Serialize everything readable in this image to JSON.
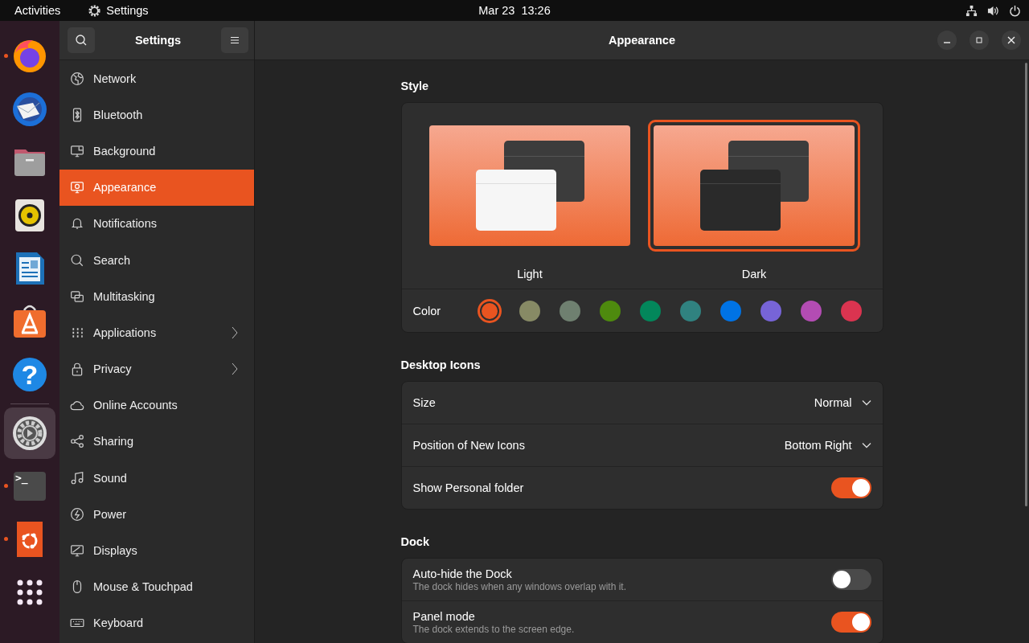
{
  "top_bar": {
    "activities": "Activities",
    "app_name": "Settings",
    "clock": "Mar 23  13:26"
  },
  "dock": {
    "items": [
      {
        "kind": "browser",
        "running": true,
        "selected": false
      },
      {
        "kind": "mail",
        "running": false,
        "selected": false
      },
      {
        "kind": "files",
        "running": false,
        "selected": false
      },
      {
        "kind": "music",
        "running": false,
        "selected": false
      },
      {
        "kind": "writer",
        "running": false,
        "selected": false
      },
      {
        "kind": "store",
        "running": false,
        "selected": false
      },
      {
        "kind": "help",
        "running": false,
        "selected": false,
        "glyph": "?"
      },
      {
        "kind": "separator"
      },
      {
        "kind": "settings",
        "running": true,
        "selected": true
      },
      {
        "kind": "terminal",
        "running": true,
        "selected": false,
        "glyph": ">_"
      },
      {
        "kind": "ubuntu",
        "running": true,
        "selected": false
      },
      {
        "kind": "apps",
        "running": false,
        "selected": false
      }
    ]
  },
  "sidebar": {
    "title": "Settings",
    "items": [
      {
        "label": "Network",
        "selected": false,
        "submenu": false
      },
      {
        "label": "Bluetooth",
        "selected": false,
        "submenu": false
      },
      {
        "label": "Background",
        "selected": false,
        "submenu": false
      },
      {
        "label": "Appearance",
        "selected": true,
        "submenu": false
      },
      {
        "label": "Notifications",
        "selected": false,
        "submenu": false
      },
      {
        "label": "Search",
        "selected": false,
        "submenu": false
      },
      {
        "label": "Multitasking",
        "selected": false,
        "submenu": false
      },
      {
        "label": "Applications",
        "selected": false,
        "submenu": true
      },
      {
        "label": "Privacy",
        "selected": false,
        "submenu": true
      },
      {
        "label": "Online Accounts",
        "selected": false,
        "submenu": false
      },
      {
        "label": "Sharing",
        "selected": false,
        "submenu": false
      },
      {
        "label": "Sound",
        "selected": false,
        "submenu": false
      },
      {
        "label": "Power",
        "selected": false,
        "submenu": false
      },
      {
        "label": "Displays",
        "selected": false,
        "submenu": false
      },
      {
        "label": "Mouse & Touchpad",
        "selected": false,
        "submenu": false
      },
      {
        "label": "Keyboard",
        "selected": false,
        "submenu": false
      }
    ]
  },
  "window": {
    "title": "Appearance"
  },
  "style": {
    "heading": "Style",
    "options": [
      {
        "label": "Light",
        "kind": "light",
        "selected": false
      },
      {
        "label": "Dark",
        "kind": "dark",
        "selected": true
      }
    ],
    "color_label": "Color",
    "colors": [
      {
        "color": "#e95420",
        "selected": true
      },
      {
        "color": "#878a65",
        "selected": false
      },
      {
        "color": "#6f8070",
        "selected": false
      },
      {
        "color": "#4e8a0e",
        "selected": false
      },
      {
        "color": "#03875b",
        "selected": false
      },
      {
        "color": "#308280",
        "selected": false
      },
      {
        "color": "#0073e5",
        "selected": false
      },
      {
        "color": "#7764d8",
        "selected": false
      },
      {
        "color": "#b34cb3",
        "selected": false
      },
      {
        "color": "#da3450",
        "selected": false
      }
    ]
  },
  "sections": [
    {
      "heading": "Desktop Icons",
      "rows": [
        {
          "kind": "dropdown",
          "label": "Size",
          "value": "Normal"
        },
        {
          "kind": "dropdown",
          "label": "Position of New Icons",
          "value": "Bottom Right"
        },
        {
          "kind": "switch",
          "label": "Show Personal folder",
          "on": true
        }
      ]
    },
    {
      "heading": "Dock",
      "rows": [
        {
          "kind": "switch",
          "label": "Auto-hide the Dock",
          "subtitle": "The dock hides when any windows overlap with it.",
          "on": false
        },
        {
          "kind": "switch",
          "label": "Panel mode",
          "subtitle": "The dock extends to the screen edge.",
          "on": true
        }
      ]
    }
  ]
}
